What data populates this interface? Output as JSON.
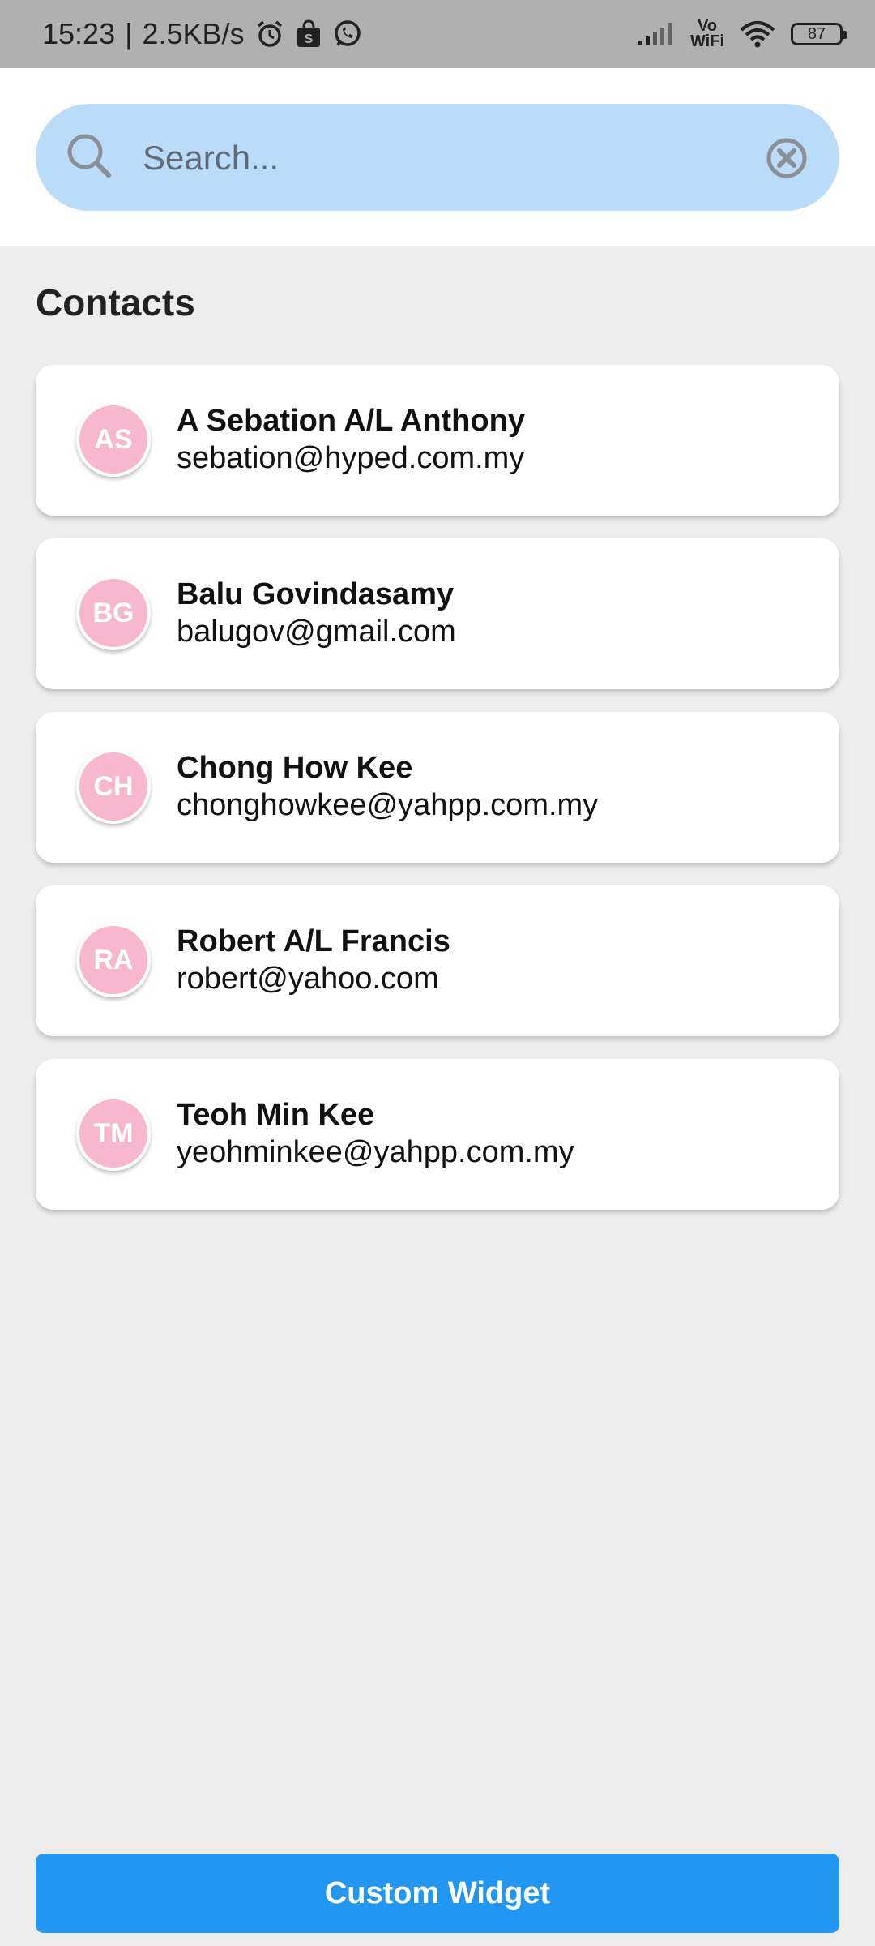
{
  "status_bar": {
    "time": "15:23",
    "separator": "|",
    "net_speed": "2.5KB/s",
    "vowifi_top": "Vo",
    "vowifi_bottom": "WiFi",
    "battery": "87",
    "icons": [
      "alarm-icon",
      "shopping-bag-icon",
      "whatsapp-icon",
      "signal-icon",
      "wifi-icon",
      "battery-icon"
    ]
  },
  "search": {
    "placeholder": "Search..."
  },
  "contacts": {
    "title": "Contacts",
    "items": [
      {
        "initials": "AS",
        "name": "A Sebation A/L Anthony",
        "email": "sebation@hyped.com.my"
      },
      {
        "initials": "BG",
        "name": "Balu Govindasamy",
        "email": "balugov@gmail.com"
      },
      {
        "initials": "CH",
        "name": "Chong How Kee",
        "email": "chonghowkee@yahpp.com.my"
      },
      {
        "initials": "RA",
        "name": "Robert A/L Francis",
        "email": "robert@yahoo.com"
      },
      {
        "initials": "TM",
        "name": "Teoh Min Kee",
        "email": "yeohminkee@yahpp.com.my"
      }
    ]
  },
  "footer": {
    "button_label": "Custom Widget"
  },
  "colors": {
    "search_bg": "#bbdcf8",
    "avatar_bg": "#f6b7cf",
    "button_bg": "#2196f3",
    "page_bg": "#ededed"
  }
}
